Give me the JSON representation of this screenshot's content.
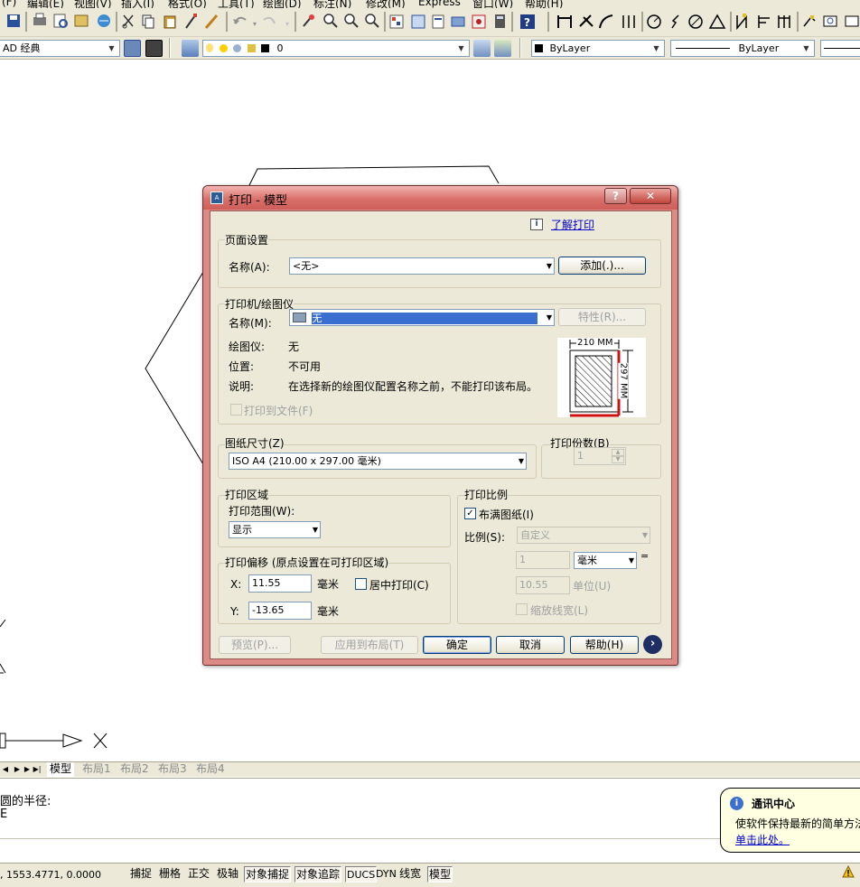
{
  "menubar": {
    "items": [
      "(F)",
      "编辑(E)",
      "视图(V)",
      "插入(I)",
      "格式(O)",
      "工具(T)",
      "绘图(D)",
      "标注(N)",
      "修改(M)",
      "Express",
      "窗口(W)",
      "帮助(H)"
    ]
  },
  "toolbar2": {
    "workspace_value": "AD 经典",
    "layer_value": "0",
    "color_value": "ByLayer",
    "linetype_value": "ByLayer"
  },
  "tabs": {
    "items": [
      "模型",
      "布局1",
      "布局2",
      "布局3",
      "布局4"
    ],
    "active": "模型"
  },
  "command": {
    "line1": "圆的半径:",
    "line2": "E"
  },
  "status": {
    "coords": ", 1553.4771, 0.0000",
    "buttons": [
      {
        "label": "捕捉",
        "on": false
      },
      {
        "label": "栅格",
        "on": false
      },
      {
        "label": "正交",
        "on": false
      },
      {
        "label": "极轴",
        "on": false
      },
      {
        "label": "对象捕捉",
        "on": true
      },
      {
        "label": "对象追踪",
        "on": true
      },
      {
        "label": "DUCS",
        "on": true
      },
      {
        "label": "DYN",
        "on": false
      },
      {
        "label": "线宽",
        "on": false
      },
      {
        "label": "模型",
        "on": true
      }
    ]
  },
  "balloon": {
    "title": "通讯中心",
    "body": "使软件保持最新的简单方法",
    "link": "单击此处。"
  },
  "dialog": {
    "title": "打印 - 模型",
    "help_link": "了解打印",
    "page_setup": {
      "group_label": "页面设置",
      "name_label": "名称(A):",
      "name_value": "<无>",
      "add_button": "添加(.)..."
    },
    "plotter": {
      "group_label": "打印机/绘图仪",
      "name_label": "名称(M):",
      "name_value": "无",
      "properties_button": "特性(R)...",
      "plotter_label": "绘图仪:",
      "plotter_value": "无",
      "where_label": "位置:",
      "where_value": "不可用",
      "desc_label": "说明:",
      "desc_value": "在选择新的绘图仪配置名称之前，不能打印该布局。",
      "plot_to_file": "打印到文件(F)",
      "preview_width": "210 MM",
      "preview_height": "297 MM"
    },
    "paper_size": {
      "group_label": "图纸尺寸(Z)",
      "value": "ISO A4 (210.00 x 297.00 毫米)"
    },
    "copies": {
      "group_label": "打印份数(B)",
      "value": "1"
    },
    "plot_area": {
      "group_label": "打印区域",
      "what_label": "打印范围(W):",
      "what_value": "显示"
    },
    "plot_offset": {
      "group_label": "打印偏移 (原点设置在可打印区域)",
      "x_label": "X:",
      "x_value": "11.55",
      "x_unit": "毫米",
      "y_label": "Y:",
      "y_value": "-13.65",
      "y_unit": "毫米",
      "center_label": "居中打印(C)"
    },
    "plot_scale": {
      "group_label": "打印比例",
      "fit_label": "布满图纸(I)",
      "fit_checked": true,
      "scale_label": "比例(S):",
      "scale_value": "自定义",
      "numerator": "1",
      "unit_value": "毫米",
      "equals": "=",
      "denominator": "10.55",
      "unit2": "单位(U)",
      "lineweights_label": "缩放线宽(L)"
    },
    "buttons": {
      "preview": "预览(P)...",
      "apply": "应用到布局(T)",
      "ok": "确定",
      "cancel": "取消",
      "help": "帮助(H)"
    }
  }
}
